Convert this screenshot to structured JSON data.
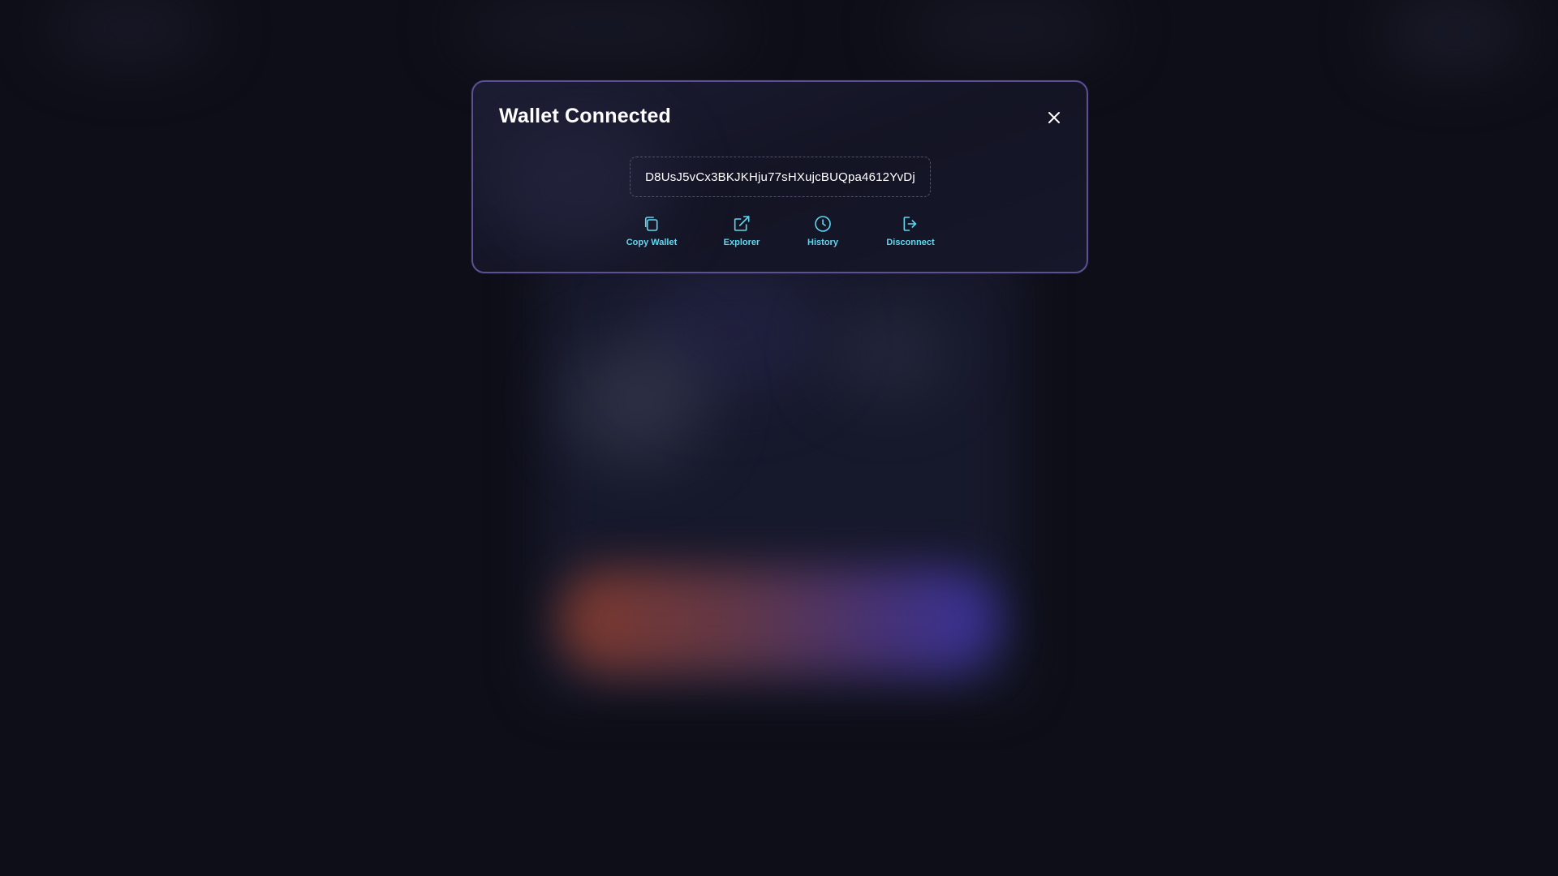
{
  "modal": {
    "title": "Wallet Connected",
    "address": "D8UsJ5vCx3BKJKHju77sHXujcBUQpa4612YvDj",
    "actions": [
      {
        "label": "Copy Wallet",
        "icon": "copy-icon"
      },
      {
        "label": "Explorer",
        "icon": "external-link-icon"
      },
      {
        "label": "History",
        "icon": "clock-icon"
      },
      {
        "label": "Disconnect",
        "icon": "logout-icon"
      }
    ],
    "close_icon": "close-icon"
  },
  "colors": {
    "background": "#0d0e17",
    "modal_border": "#5c4f93",
    "accent": "#5ed8f0",
    "text": "#ffffff"
  }
}
